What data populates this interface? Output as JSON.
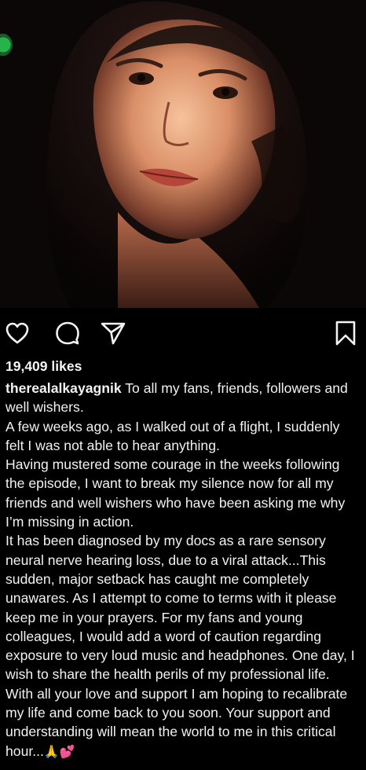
{
  "post": {
    "likes": "19,409 likes",
    "username": "therealalkayagnik",
    "caption_first": "To all my fans, friends, followers and well wishers.",
    "caption_paragraphs": [
      "A few weeks ago, as I walked out of a flight, I suddenly felt I was not able to hear anything.",
      "Having mustered some courage in the weeks following the episode, I want to break my silence now for all my friends and well wishers who have been asking me why I’m missing in action.",
      "It has been diagnosed by my docs as a rare sensory neural nerve hearing loss, due to a viral attack...This sudden, major setback has caught me completely unawares. As I attempt to come to terms with it please keep me in your prayers. For my fans and young colleagues, I would add a word of caution regarding exposure to very loud music and headphones. One day, I wish to share the health perils of my professional life.  With all your love and support I am hoping to recalibrate my life and come back to you soon. Your support and understanding will mean the world to me in this critical hour..."
    ],
    "caption_emojis": "🙏💕"
  },
  "icons": {
    "like": "heart-icon",
    "comment": "comment-bubble-icon",
    "share": "send-icon",
    "save": "bookmark-icon"
  }
}
